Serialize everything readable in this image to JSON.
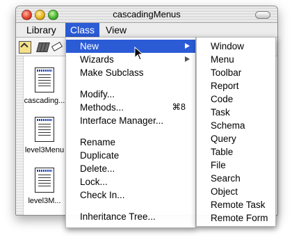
{
  "window": {
    "title": "cascadingMenus"
  },
  "menubar": {
    "items": [
      "Library",
      "Class",
      "View"
    ],
    "active_index": 1
  },
  "files": [
    {
      "name": "cascading..."
    },
    {
      "name": "level3Menu"
    },
    {
      "name": "level3M..."
    }
  ],
  "class_menu": {
    "items": [
      {
        "label": "New",
        "submenu": true,
        "highlighted": true
      },
      {
        "label": "Wizards",
        "submenu": true
      },
      {
        "label": "Make Subclass"
      },
      {
        "label": "Modify..."
      },
      {
        "label": "Methods...",
        "shortcut": "⌘8"
      },
      {
        "label": "Interface Manager..."
      },
      {
        "label": "Rename"
      },
      {
        "label": "Duplicate"
      },
      {
        "label": "Delete..."
      },
      {
        "label": "Lock..."
      },
      {
        "label": "Check In..."
      },
      {
        "label": "Inheritance Tree..."
      }
    ]
  },
  "new_submenu": {
    "items": [
      "Window",
      "Menu",
      "Toolbar",
      "Report",
      "Code",
      "Task",
      "Schema",
      "Query",
      "Table",
      "File",
      "Search",
      "Object",
      "Remote Task",
      "Remote Form"
    ]
  },
  "colors": {
    "highlight": "#2b5cd6"
  },
  "icons": [
    "close-light",
    "minimize-light",
    "zoom-light",
    "toolbar-pill",
    "folder-up-icon",
    "books-icon",
    "eraser-icon",
    "document-icon",
    "submenu-arrow-icon",
    "pointer-cursor-icon"
  ]
}
